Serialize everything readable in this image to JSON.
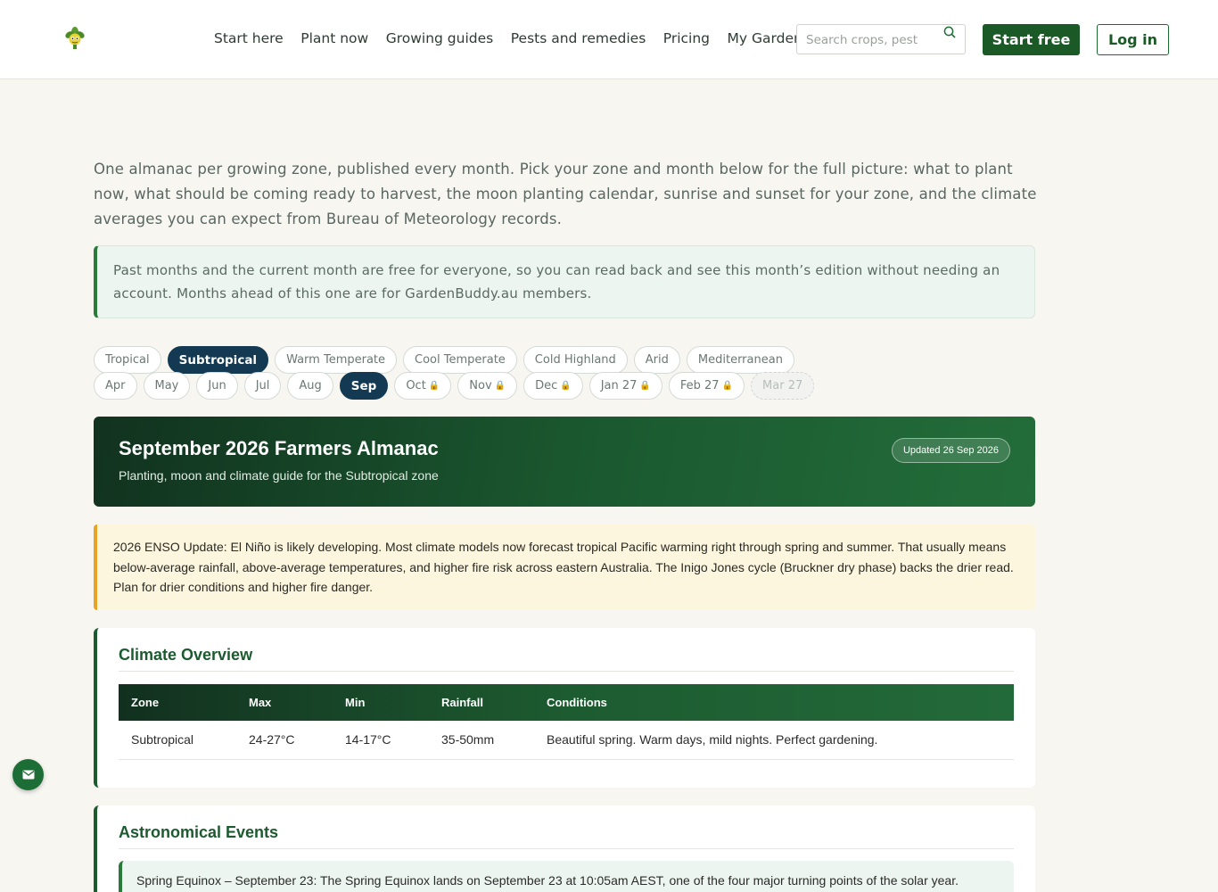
{
  "header": {
    "nav": [
      "Start here",
      "Plant now",
      "Growing guides",
      "Pests and remedies",
      "Pricing",
      "My Garden"
    ],
    "search_placeholder": "Search crops, pest",
    "start_label": "Start free",
    "login_label": "Log in"
  },
  "intro": {
    "text": "One almanac per growing zone, published every month. Pick your zone and month below for the full picture: what to plant now, what should be coming ready to harvest, the moon planting calendar, sunrise and sunset for your zone, and the climate averages you can expect from Bureau of Meteorology records.",
    "notice": "Past months and the current month are free for everyone, so you can read back and see this month’s edition without needing an account. Months ahead of this one are for GardenBuddy.au members."
  },
  "zones": [
    "Tropical",
    "Subtropical",
    "Warm Temperate",
    "Cool Temperate",
    "Cold Highland",
    "Arid",
    "Mediterranean"
  ],
  "selected_zone": "Subtropical",
  "months": [
    {
      "label": "Apr",
      "state": "free"
    },
    {
      "label": "May",
      "state": "free"
    },
    {
      "label": "Jun",
      "state": "free"
    },
    {
      "label": "Jul",
      "state": "free"
    },
    {
      "label": "Aug",
      "state": "free"
    },
    {
      "label": "Sep",
      "state": "active"
    },
    {
      "label": "Oct",
      "state": "locked"
    },
    {
      "label": "Nov",
      "state": "locked"
    },
    {
      "label": "Dec",
      "state": "locked"
    },
    {
      "label": "Jan 27",
      "state": "locked"
    },
    {
      "label": "Feb 27",
      "state": "locked"
    },
    {
      "label": "Mar 27",
      "state": "disabled"
    }
  ],
  "hero": {
    "title": "September 2026 Farmers Almanac",
    "subtitle": "Planting, moon and climate guide for the Subtropical zone",
    "updated": "Updated 26 Sep 2026"
  },
  "enso": {
    "text": "2026 ENSO Update: El Niño is likely developing. Most climate models now forecast tropical Pacific warming right through spring and summer. That usually means below-average rainfall, above-average temperatures, and higher fire risk across eastern Australia. The Inigo Jones cycle (Bruckner dry phase) backs the drier read. Plan for drier conditions and higher fire danger."
  },
  "climate": {
    "title": "Climate Overview",
    "headers": [
      "Zone",
      "Max",
      "Min",
      "Rainfall",
      "Conditions"
    ],
    "row": [
      "Subtropical",
      "24-27°C",
      "14-17°C",
      "35-50mm",
      "Beautiful spring. Warm days, mild nights. Perfect gardening."
    ]
  },
  "astro": {
    "title": "Astronomical Events",
    "event": "Spring Equinox – September 23: The Spring Equinox lands on September 23 at 10:05am AEST, one of the four major turning points of the solar year."
  },
  "colors": {
    "brand_green": "#1b5a26",
    "active_pill": "#133a52",
    "warning_accent": "#e6a325"
  },
  "icons": {
    "logo": "plant-logo-icon",
    "search": "search-icon",
    "lock": "lock-icon",
    "fab": "mail-icon"
  }
}
